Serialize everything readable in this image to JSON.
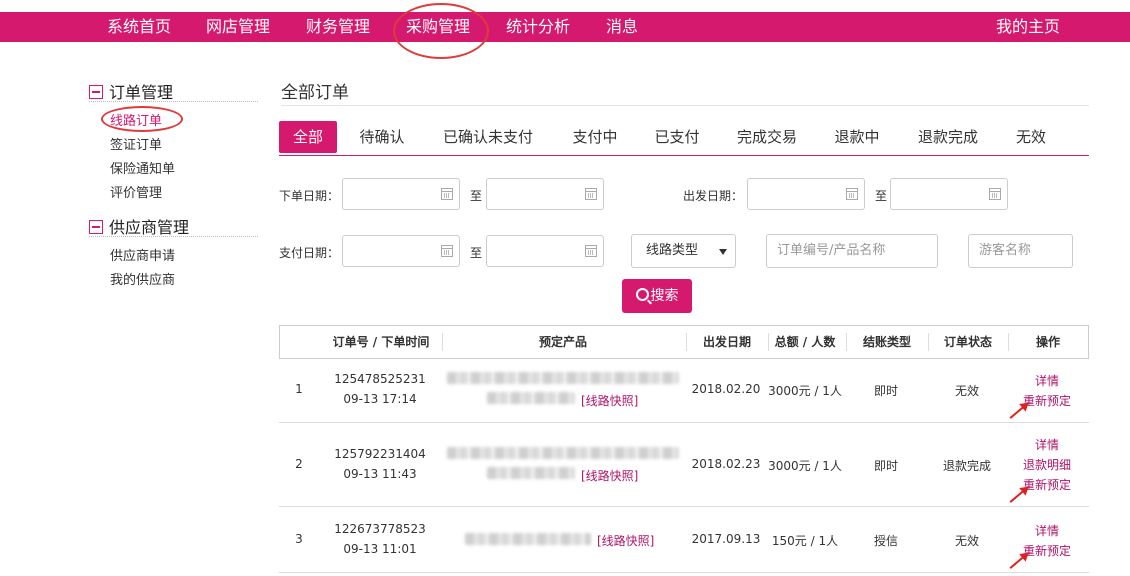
{
  "nav": {
    "items": [
      "系统首页",
      "网店管理",
      "财务管理",
      "采购管理",
      "统计分析",
      "消息"
    ],
    "my_home": "我的主页"
  },
  "sidebar": {
    "sections": [
      {
        "title": "订单管理",
        "items": [
          "线路订单",
          "签证订单",
          "保险通知单",
          "评价管理"
        ]
      },
      {
        "title": "供应商管理",
        "items": [
          "供应商申请",
          "我的供应商"
        ]
      }
    ],
    "active_item": "线路订单"
  },
  "page_title": "全部订单",
  "tabs": [
    "全部",
    "待确认",
    "已确认未支付",
    "支付中",
    "已支付",
    "完成交易",
    "退款中",
    "退款完成",
    "无效"
  ],
  "active_tab": "全部",
  "filters": {
    "order_date_label": "下单日期：",
    "depart_date_label": "出发日期：",
    "pay_date_label": "支付日期：",
    "to_label": "至",
    "route_type": "线路类型",
    "order_no_placeholder": "订单编号/产品名称",
    "guest_placeholder": "游客名称",
    "search_label": "搜索"
  },
  "table": {
    "headers": [
      "订单号 / 下单时间",
      "预定产品",
      "出发日期",
      "总额 / 人数",
      "结账类型",
      "订单状态",
      "操作"
    ],
    "snapshot_label": "[线路快照]",
    "rows": [
      {
        "index": "1",
        "order_no": "125478525231",
        "time": "09-13 17:14",
        "depart": "2018.02.20",
        "total": "3000元 / 1人",
        "pay_type": "即时",
        "status": "无效",
        "actions": [
          "详情",
          "重新预定"
        ]
      },
      {
        "index": "2",
        "order_no": "125792231404",
        "time": "09-13 11:43",
        "depart": "2018.02.23",
        "total": "3000元 / 1人",
        "pay_type": "即时",
        "status": "退款完成",
        "actions": [
          "详情",
          "退款明细",
          "重新预定"
        ]
      },
      {
        "index": "3",
        "order_no": "122673778523",
        "time": "09-13 11:01",
        "depart": "2017.09.13",
        "total": "150元 / 1人",
        "pay_type": "授信",
        "status": "无效",
        "actions": [
          "详情",
          "重新预定"
        ]
      }
    ]
  },
  "colors": {
    "accent": "#d4196e",
    "link": "#b0136a",
    "annotation": "#e03a3a"
  }
}
